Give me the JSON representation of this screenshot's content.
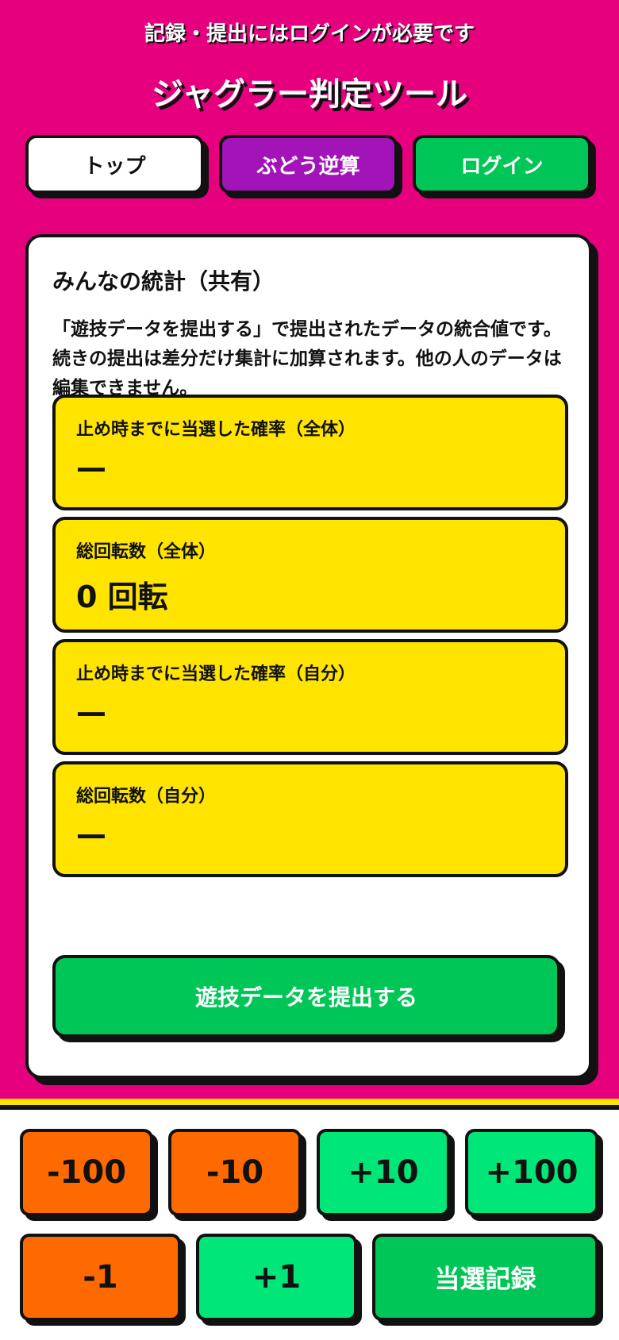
{
  "header": {
    "notice": "記録・提出にはログインが必要です",
    "title": "ジャグラー判定ツール"
  },
  "nav": {
    "top": "トップ",
    "grape": "ぶどう逆算",
    "login": "ログイン"
  },
  "stats": {
    "heading": "みんなの統計（共有）",
    "description": "「遊技データを提出する」で提出されたデータの統合値です。続きの提出は差分だけ集計に加算されます。他の人のデータは編集できません。",
    "items": [
      {
        "label": "止め時までに当選した確率（全体）",
        "value": "—"
      },
      {
        "label": "総回転数（全体）",
        "value": "0 回転"
      },
      {
        "label": "止め時までに当選した確率（自分）",
        "value": "—"
      },
      {
        "label": "総回転数（自分）",
        "value": "—"
      }
    ],
    "submit_label": "遊技データを提出する"
  },
  "keypad": {
    "minus100": "-100",
    "minus10": "-10",
    "plus10": "+10",
    "plus100": "+100",
    "minus1": "-1",
    "plus1": "+1",
    "record": "当選記録"
  }
}
